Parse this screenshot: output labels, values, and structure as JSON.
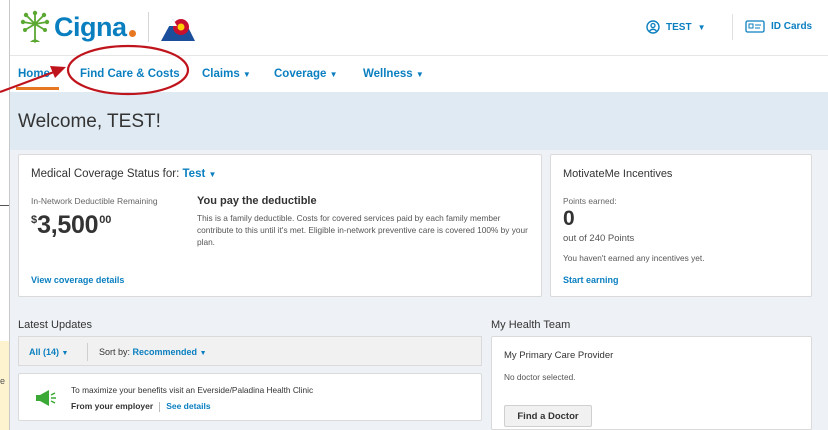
{
  "brand": {
    "name": "Cigna",
    "primary": "#0a7fc0",
    "accent": "#e87722"
  },
  "header": {
    "user_label": "TEST",
    "id_cards_label": "ID Cards"
  },
  "nav": {
    "items": [
      {
        "label": "Home",
        "active": true
      },
      {
        "label": "Find Care & Costs"
      },
      {
        "label": "Claims"
      },
      {
        "label": "Coverage"
      },
      {
        "label": "Wellness"
      }
    ]
  },
  "welcome": "Welcome, TEST!",
  "coverage": {
    "title": "Medical Coverage Status for:",
    "member": "Test",
    "deductible_label": "In-Network Deductible Remaining",
    "currency": "$",
    "amount": "3,500",
    "cents": "00",
    "pay_title": "You pay the deductible",
    "pay_desc": "This is a family deductible. Costs for covered services paid by each family member contribute to this until it's met. Eligible in-network preventive care is covered 100% by your plan.",
    "link": "View coverage details"
  },
  "motivateme": {
    "title": "MotivateMe Incentives",
    "points_label": "Points earned:",
    "points": "0",
    "out_of": "out of 240 Points",
    "none_text": "You haven't earned any incentives yet.",
    "link": "Start earning"
  },
  "updates": {
    "heading": "Latest Updates",
    "filter_all": "All (14)",
    "sort_label": "Sort by:",
    "sort_value": "Recommended",
    "item_text": "To maximize your benefits visit an Everside/Paladina Health Clinic",
    "item_from": "From your employer",
    "item_link": "See details"
  },
  "health_team": {
    "heading": "My Health Team",
    "title": "My Primary Care Provider",
    "none_text": "No doctor selected.",
    "button": "Find a Doctor"
  },
  "background_fragment": "e"
}
